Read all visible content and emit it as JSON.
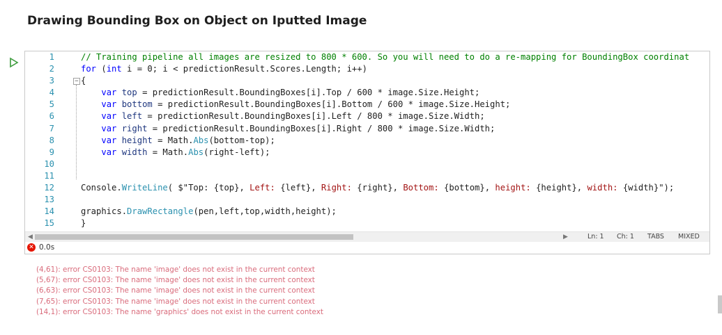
{
  "title": "Drawing Bounding Box on Object on Iputted Image",
  "run_icon": "run-triangle-icon",
  "line_numbers": [
    "1",
    "2",
    "3",
    "4",
    "5",
    "6",
    "7",
    "8",
    "9",
    "10",
    "11",
    "12",
    "13",
    "14",
    "15"
  ],
  "code_lines": [
    [
      {
        "t": "// Training pipeline all images are resized to 800 * 600. So you will need to do a re-mapping for BoundingBox coordinat",
        "c": "comment"
      }
    ],
    [
      {
        "t": "for",
        "c": "kw"
      },
      {
        "t": " (",
        "c": "plain"
      },
      {
        "t": "int",
        "c": "kw"
      },
      {
        "t": " i = 0; i < predictionResult.Scores.Length; i++)",
        "c": "plain"
      }
    ],
    [
      {
        "t": "{",
        "c": "plain"
      }
    ],
    [
      {
        "t": "    ",
        "c": "plain"
      },
      {
        "t": "var",
        "c": "kw"
      },
      {
        "t": " ",
        "c": "plain"
      },
      {
        "t": "top",
        "c": "var"
      },
      {
        "t": " = predictionResult.BoundingBoxes[i].Top / 600 * image.Size.Height;",
        "c": "plain"
      }
    ],
    [
      {
        "t": "    ",
        "c": "plain"
      },
      {
        "t": "var",
        "c": "kw"
      },
      {
        "t": " ",
        "c": "plain"
      },
      {
        "t": "bottom",
        "c": "var"
      },
      {
        "t": " = predictionResult.BoundingBoxes[i].Bottom / 600 * image.Size.Height;",
        "c": "plain"
      }
    ],
    [
      {
        "t": "    ",
        "c": "plain"
      },
      {
        "t": "var",
        "c": "kw"
      },
      {
        "t": " ",
        "c": "plain"
      },
      {
        "t": "left",
        "c": "var"
      },
      {
        "t": " = predictionResult.BoundingBoxes[i].Left / 800 * image.Size.Width;",
        "c": "plain"
      }
    ],
    [
      {
        "t": "    ",
        "c": "plain"
      },
      {
        "t": "var",
        "c": "kw"
      },
      {
        "t": " ",
        "c": "plain"
      },
      {
        "t": "right",
        "c": "var"
      },
      {
        "t": " = predictionResult.BoundingBoxes[i].Right / 800 * image.Size.Width;",
        "c": "plain"
      }
    ],
    [
      {
        "t": "    ",
        "c": "plain"
      },
      {
        "t": "var",
        "c": "kw"
      },
      {
        "t": " ",
        "c": "plain"
      },
      {
        "t": "height",
        "c": "var"
      },
      {
        "t": " = Math.",
        "c": "plain"
      },
      {
        "t": "Abs",
        "c": "method"
      },
      {
        "t": "(bottom-top);",
        "c": "plain"
      }
    ],
    [
      {
        "t": "    ",
        "c": "plain"
      },
      {
        "t": "var",
        "c": "kw"
      },
      {
        "t": " ",
        "c": "plain"
      },
      {
        "t": "width",
        "c": "var"
      },
      {
        "t": " = Math.",
        "c": "plain"
      },
      {
        "t": "Abs",
        "c": "method"
      },
      {
        "t": "(right-left);",
        "c": "plain"
      }
    ],
    [
      {
        "t": "",
        "c": "plain"
      }
    ],
    [
      {
        "t": "",
        "c": "plain"
      }
    ],
    [
      {
        "t": "Console.",
        "c": "plain"
      },
      {
        "t": "WriteLine",
        "c": "method"
      },
      {
        "t": "( $\"Top: {top}, ",
        "c": "plain"
      },
      {
        "t": "Left: ",
        "c": "str"
      },
      {
        "t": "{left}, ",
        "c": "plain"
      },
      {
        "t": "Right: ",
        "c": "str"
      },
      {
        "t": "{right}, ",
        "c": "plain"
      },
      {
        "t": "Bottom: ",
        "c": "str"
      },
      {
        "t": "{bottom}, ",
        "c": "plain"
      },
      {
        "t": "height: ",
        "c": "str"
      },
      {
        "t": "{height}, ",
        "c": "plain"
      },
      {
        "t": "width: ",
        "c": "str"
      },
      {
        "t": "{width}\");",
        "c": "plain"
      }
    ],
    [
      {
        "t": "",
        "c": "plain"
      }
    ],
    [
      {
        "t": "graphics.",
        "c": "plain"
      },
      {
        "t": "DrawRectangle",
        "c": "method"
      },
      {
        "t": "(pen,left,top,width,height);",
        "c": "plain"
      }
    ],
    [
      {
        "t": "}",
        "c": "plain"
      }
    ]
  ],
  "status": {
    "ln": "Ln: 1",
    "ch": "Ch: 1",
    "tabs": "TABS",
    "mode": "MIXED"
  },
  "result": {
    "error_icon": "error-circle-icon",
    "duration": "0.0s"
  },
  "errors": [
    "(4,61): error CS0103: The name 'image' does not exist in the current context",
    "(5,67): error CS0103: The name 'image' does not exist in the current context",
    "(6,63): error CS0103: The name 'image' does not exist in the current context",
    "(7,65): error CS0103: The name 'image' does not exist in the current context",
    "(14,1): error CS0103: The name 'graphics' does not exist in the current context"
  ],
  "colors": {
    "comment": "#008000",
    "keyword": "#0000ff",
    "line_number": "#2b91af",
    "error_text": "#d96b7b",
    "error_icon": "#e51400"
  }
}
